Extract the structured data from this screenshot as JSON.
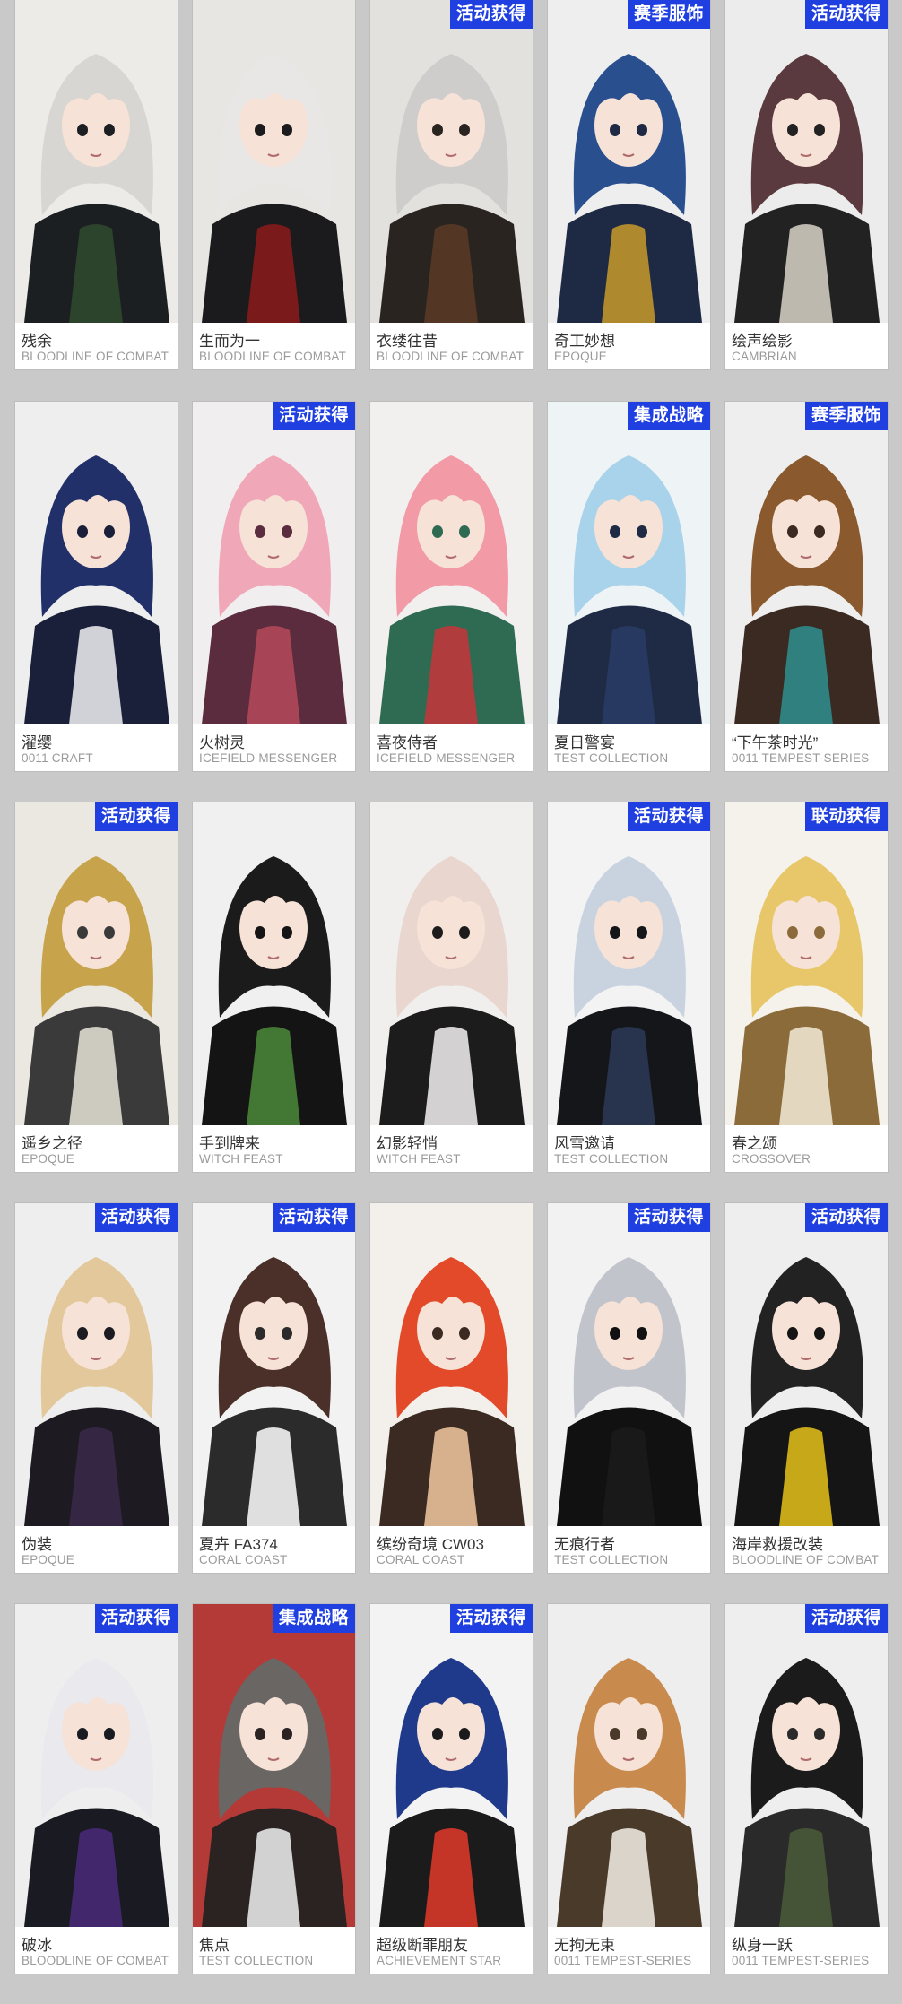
{
  "cards": [
    {
      "name": "残余",
      "series": "BLOODLINE OF COMBAT",
      "badge": "",
      "bg": "#ecebe8",
      "hair": "#d8d6d2",
      "accent": "#2f4a2e",
      "dark": "#1c1f22"
    },
    {
      "name": "生而为一",
      "series": "BLOODLINE OF COMBAT",
      "badge": "",
      "bg": "#e8e6e3",
      "hair": "#e9e6e6",
      "accent": "#8b1a1a",
      "dark": "#1b1b1d"
    },
    {
      "name": "衣缕往昔",
      "series": "BLOODLINE OF COMBAT",
      "badge": "活动获得",
      "bg": "#e3e1de",
      "hair": "#cfcdcc",
      "accent": "#5a3b26",
      "dark": "#2a2420"
    },
    {
      "name": "奇工妙想",
      "series": "EPOQUE",
      "badge": "赛季服饰",
      "bg": "#eeeeee",
      "hair": "#2a4f8f",
      "accent": "#c89a2a",
      "dark": "#1e2a44"
    },
    {
      "name": "绘声绘影",
      "series": "CAMBRIAN",
      "badge": "活动获得",
      "bg": "#ececec",
      "hair": "#5a3a3f",
      "accent": "#d9d4c8",
      "dark": "#222222"
    },
    {
      "name": "濯缨",
      "series": "0011 CRAFT",
      "badge": "",
      "bg": "#eeeeee",
      "hair": "#22306a",
      "accent": "#f2f2f4",
      "dark": "#1a1f3a"
    },
    {
      "name": "火树灵",
      "series": "ICEFIELD MESSENGER",
      "badge": "活动获得",
      "bg": "#f1eef0",
      "hair": "#f0a7b8",
      "accent": "#b5495b",
      "dark": "#5b2c3e"
    },
    {
      "name": "喜夜侍者",
      "series": "ICEFIELD MESSENGER",
      "badge": "",
      "bg": "#f2efef",
      "hair": "#f29aa6",
      "accent": "#c8343a",
      "dark": "#2f6b52"
    },
    {
      "name": "夏日警宴",
      "series": "TEST COLLECTION",
      "badge": "集成战略",
      "bg": "#eef3f5",
      "hair": "#a9d3ea",
      "accent": "#2a3c66",
      "dark": "#1f2a44"
    },
    {
      "name": "“下午茶时光”",
      "series": "0011 TEMPEST-SERIES",
      "badge": "赛季服饰",
      "bg": "#eeeeee",
      "hair": "#8a5a2e",
      "accent": "#2f8f8f",
      "dark": "#3a2a22"
    },
    {
      "name": "遥乡之径",
      "series": "EPOQUE",
      "badge": "活动获得",
      "bg": "#ebe8e2",
      "hair": "#c7a34c",
      "accent": "#e8e4d8",
      "dark": "#3a3a3a"
    },
    {
      "name": "手到牌来",
      "series": "WITCH FEAST",
      "badge": "",
      "bg": "#f0f0f0",
      "hair": "#1b1b1b",
      "accent": "#4b8a3a",
      "dark": "#141414"
    },
    {
      "name": "幻影轻悄",
      "series": "WITCH FEAST",
      "badge": "",
      "bg": "#f1eeee",
      "hair": "#e8d6cf",
      "accent": "#f3f1f1",
      "dark": "#1c1c1c"
    },
    {
      "name": "风雪邀请",
      "series": "TEST COLLECTION",
      "badge": "活动获得",
      "bg": "#f3f3f3",
      "hair": "#c9d3e0",
      "accent": "#2b3a57",
      "dark": "#15161a"
    },
    {
      "name": "春之颂",
      "series": "CROSSOVER",
      "badge": "联动获得",
      "bg": "#f4f2ea",
      "hair": "#e7c76a",
      "accent": "#f2ead8",
      "dark": "#8c6b3a"
    },
    {
      "name": "伪装",
      "series": "EPOQUE",
      "badge": "活动获得",
      "bg": "#eeeeee",
      "hair": "#e2c89a",
      "accent": "#3a2a4a",
      "dark": "#1d1a22"
    },
    {
      "name": "夏卉 FA374",
      "series": "CORAL COAST",
      "badge": "活动获得",
      "bg": "#f2f2f2",
      "hair": "#4a3029",
      "accent": "#ffffff",
      "dark": "#2b2b2b"
    },
    {
      "name": "缤纷奇境 CW03",
      "series": "CORAL COAST",
      "badge": "",
      "bg": "#f3efeb",
      "hair": "#e24a2a",
      "accent": "#f3c9a0",
      "dark": "#3a2a22"
    },
    {
      "name": "无痕行者",
      "series": "TEST COLLECTION",
      "badge": "活动获得",
      "bg": "#f2f2f2",
      "hair": "#c2c4cc",
      "accent": "#1b1b1b",
      "dark": "#111111"
    },
    {
      "name": "海岸救援改装",
      "series": "BLOODLINE OF COMBAT",
      "badge": "活动获得",
      "bg": "#eeeeee",
      "hair": "#222222",
      "accent": "#e6c21a",
      "dark": "#151515"
    },
    {
      "name": "破冰",
      "series": "BLOODLINE OF COMBAT",
      "badge": "活动获得",
      "bg": "#eeeeee",
      "hair": "#e9e9ee",
      "accent": "#4a2a7a",
      "dark": "#1a1a22"
    },
    {
      "name": "焦点",
      "series": "TEST COLLECTION",
      "badge": "集成战略",
      "bg": "#b43a38",
      "hair": "#6a6664",
      "accent": "#f1f1f1",
      "dark": "#2a2322"
    },
    {
      "name": "超级断罪朋友",
      "series": "ACHIEVEMENT STAR",
      "badge": "活动获得",
      "bg": "#f3f3f3",
      "hair": "#1f3a8a",
      "accent": "#e23a2a",
      "dark": "#1b1b1b"
    },
    {
      "name": "无拘无束",
      "series": "0011 TEMPEST-SERIES",
      "badge": "",
      "bg": "#eeeeee",
      "hair": "#c98a4e",
      "accent": "#f4f0e8",
      "dark": "#4a3a2a"
    },
    {
      "name": "纵身一跃",
      "series": "0011 TEMPEST-SERIES",
      "badge": "活动获得",
      "bg": "#eeeeee",
      "hair": "#1b1b1b",
      "accent": "#4a5a3a",
      "dark": "#2a2a2a"
    }
  ]
}
